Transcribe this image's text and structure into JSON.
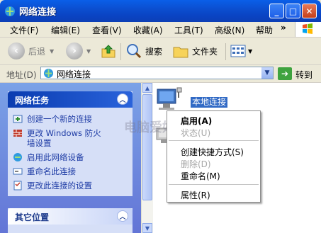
{
  "window": {
    "title": "网络连接",
    "buttons": {
      "minimize": "_",
      "maximize": "□",
      "close": "✕"
    }
  },
  "menubar": {
    "items": [
      "文件(F)",
      "编辑(E)",
      "查看(V)",
      "收藏(A)",
      "工具(T)",
      "高级(N)",
      "帮助"
    ],
    "overflow": "»"
  },
  "toolbar": {
    "back_label": "后退",
    "search_label": "搜索",
    "folders_label": "文件夹"
  },
  "address": {
    "label": "地址(D)",
    "value": "网络连接",
    "go_label": "转到"
  },
  "taskpane": {
    "network_tasks": {
      "title": "网络任务",
      "items": [
        "创建一个新的连接",
        "更改 Windows 防火墙设置",
        "启用此网络设备",
        "重命名此连接",
        "更改此连接的设置"
      ],
      "item2_line1": "更改 Windows 防火",
      "item2_line2": "墙设置"
    },
    "other_places": {
      "title": "其它位置"
    }
  },
  "content": {
    "selected_connection": "本地连接"
  },
  "watermark": "电脑爱好",
  "context_menu": {
    "items": [
      {
        "label": "启用(A)",
        "bold": true,
        "disabled": false
      },
      {
        "label": "状态(U)",
        "bold": false,
        "disabled": true
      },
      {
        "label": "创建快捷方式(S)",
        "bold": false,
        "disabled": false
      },
      {
        "label": "删除(D)",
        "bold": false,
        "disabled": true
      },
      {
        "label": "重命名(M)",
        "bold": false,
        "disabled": false
      },
      {
        "label": "属性(R)",
        "bold": false,
        "disabled": false
      }
    ]
  },
  "colors": {
    "titlebar": "#0b4fd0",
    "selection": "#316ac5",
    "taskpane": "#6f8ee0",
    "task_link": "#1c3aa4"
  }
}
